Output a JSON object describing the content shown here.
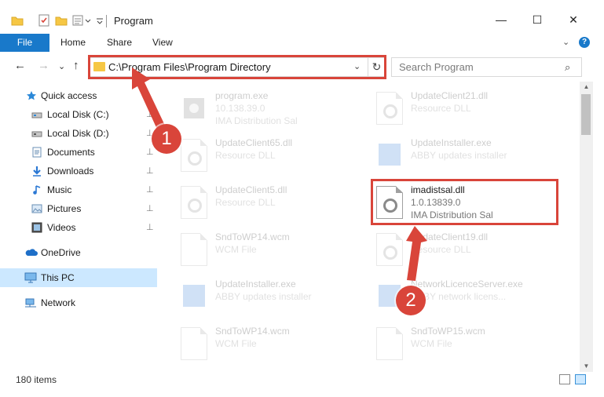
{
  "window": {
    "title": "Program",
    "minimize": "—",
    "maximize": "☐",
    "close": "✕"
  },
  "ribbon": {
    "tabs": [
      "File",
      "Home",
      "Share",
      "View"
    ],
    "expand": "⌄",
    "help": "?"
  },
  "nav": {
    "back": "←",
    "forward": "→",
    "recent": "⌄",
    "up": "↑",
    "address": "C:\\Program Files\\Program Directory",
    "address_dropdown": "⌄",
    "refresh": "↻",
    "search_placeholder": "Search Program",
    "search_icon": "⌕"
  },
  "sidebar": {
    "items": [
      {
        "label": "Quick access",
        "icon": "star-icon",
        "pinned": false
      },
      {
        "label": "Local Disk (C:)",
        "icon": "drive-icon",
        "pinned": true
      },
      {
        "label": "Local Disk (D:)",
        "icon": "drive-icon",
        "pinned": true
      },
      {
        "label": "Documents",
        "icon": "documents-icon",
        "pinned": true
      },
      {
        "label": "Downloads",
        "icon": "downloads-icon",
        "pinned": true
      },
      {
        "label": "Music",
        "icon": "music-icon",
        "pinned": true
      },
      {
        "label": "Pictures",
        "icon": "pictures-icon",
        "pinned": true
      },
      {
        "label": "Videos",
        "icon": "videos-icon",
        "pinned": true
      },
      {
        "label": "OneDrive",
        "icon": "onedrive-icon",
        "pinned": false
      },
      {
        "label": "This PC",
        "icon": "pc-icon",
        "pinned": false,
        "selected": true
      },
      {
        "label": "Network",
        "icon": "network-icon",
        "pinned": false
      }
    ],
    "pin_glyph": "📌"
  },
  "files": [
    {
      "name": "program.exe",
      "line2": "10.138.39.0",
      "line3": "IMA Distribution Sal",
      "icon": "exe-icon"
    },
    {
      "name": "UpdateClient21.dll",
      "line2": "Resource DLL",
      "line3": "",
      "icon": "dll-icon"
    },
    {
      "name": "UpdateClient65.dll",
      "line2": "Resource DLL",
      "line3": "",
      "icon": "dll-icon"
    },
    {
      "name": "UpdateInstaller.exe",
      "line2": "ABBY updates installer",
      "line3": "",
      "icon": "installer-icon"
    },
    {
      "name": "UpdateClient5.dll",
      "line2": "Resource DLL",
      "line3": "",
      "icon": "dll-icon"
    },
    {
      "name": "imadistsal.dll",
      "line2": "1.0.13839.0",
      "line3": "IMA Distribution Sal",
      "icon": "dll-icon",
      "highlighted": true
    },
    {
      "name": "SndToWP14.wcm",
      "line2": "WCM File",
      "line3": "",
      "icon": "file-icon"
    },
    {
      "name": "UpdateClient19.dll",
      "line2": "Resource DLL",
      "line3": "",
      "icon": "dll-icon"
    },
    {
      "name": "UpdateInstaller.exe",
      "line2": "ABBY updates installer",
      "line3": "",
      "icon": "installer-icon"
    },
    {
      "name": "NetworkLicenceServer.exe",
      "line2": "ABBY network licens...",
      "line3": "",
      "icon": "installer-icon"
    },
    {
      "name": "SndToWP14.wcm",
      "line2": "WCM File",
      "line3": "",
      "icon": "file-icon"
    },
    {
      "name": "SndToWP15.wcm",
      "line2": "WCM File",
      "line3": "",
      "icon": "file-icon"
    }
  ],
  "status": {
    "items_count": "180 items"
  },
  "annotations": {
    "step1": "1",
    "step2": "2",
    "color": "#d9453a"
  }
}
